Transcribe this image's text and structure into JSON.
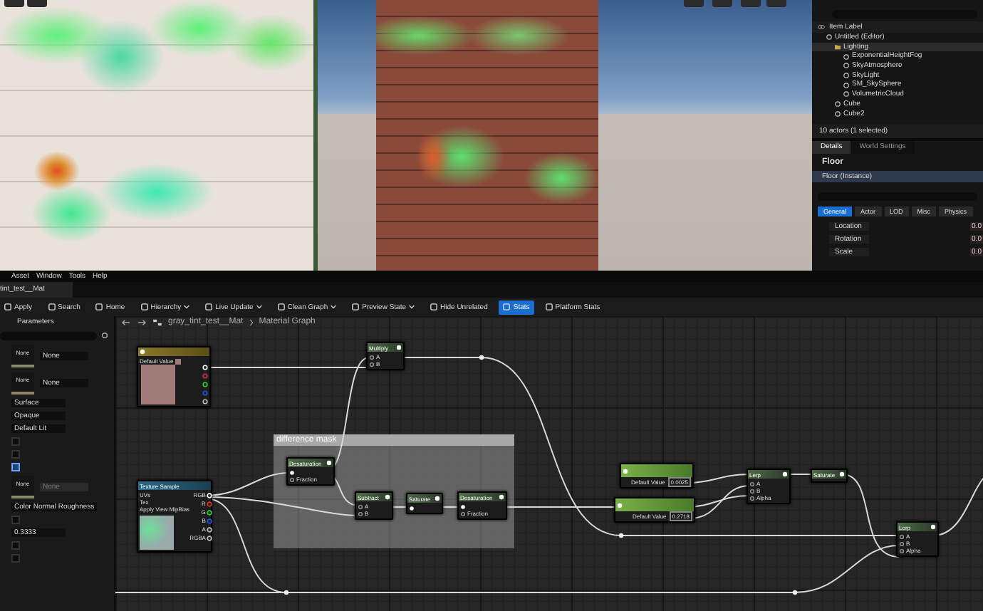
{
  "outliner": {
    "column": "Item Label",
    "items": [
      {
        "label": "Untitled (Editor)",
        "selected": false,
        "children": [
          {
            "label": "Lighting",
            "selected": true,
            "children": [
              {
                "label": "ExponentialHeightFog",
                "selected": false
              },
              {
                "label": "SkyAtmosphere",
                "selected": false
              },
              {
                "label": "SkyLight",
                "selected": false
              },
              {
                "label": "SM_SkySphere",
                "selected": false
              },
              {
                "label": "VolumetricCloud",
                "selected": false
              }
            ]
          },
          {
            "label": "Cube",
            "selected": false
          },
          {
            "label": "Cube2",
            "selected": false
          }
        ]
      }
    ],
    "status": "10 actors (1 selected)"
  },
  "details": {
    "tabs": [
      {
        "label": "Details",
        "selected": true
      },
      {
        "label": "World Settings",
        "selected": false
      }
    ],
    "actor": "Floor",
    "component": {
      "label": "Floor (Instance)",
      "selected": true
    },
    "categories": [
      {
        "label": "General",
        "selected": true
      },
      {
        "label": "Actor",
        "selected": false
      },
      {
        "label": "LOD",
        "selected": false
      },
      {
        "label": "Misc",
        "selected": false
      },
      {
        "label": "Physics",
        "selected": false
      }
    ],
    "transform": [
      {
        "label": "Location",
        "value": "0.0"
      },
      {
        "label": "Rotation",
        "value": "0.0"
      },
      {
        "label": "Scale",
        "value": "0.0"
      }
    ]
  },
  "menu": [
    "Asset",
    "Window",
    "Tools",
    "Help"
  ],
  "editor_tab": "tint_test__Mat",
  "toolbar": [
    {
      "label": "Apply",
      "selected": false,
      "dropdown": false
    },
    {
      "label": "Search",
      "selected": false,
      "dropdown": false
    },
    {
      "label": "Home",
      "selected": false,
      "dropdown": false
    },
    {
      "label": "Hierarchy",
      "selected": false,
      "dropdown": true
    },
    {
      "label": "Live Update",
      "selected": false,
      "dropdown": true
    },
    {
      "label": "Clean Graph",
      "selected": false,
      "dropdown": true
    },
    {
      "label": "Preview State",
      "selected": false,
      "dropdown": true
    },
    {
      "label": "Hide Unrelated",
      "selected": false,
      "dropdown": false
    },
    {
      "label": "Stats",
      "selected": true,
      "dropdown": false
    },
    {
      "label": "Platform Stats",
      "selected": false,
      "dropdown": false
    }
  ],
  "parameters": {
    "title": "Parameters",
    "rows": [
      {
        "kind": "slot",
        "thumb": "None",
        "value": "None",
        "disabled": false
      },
      {
        "kind": "slot",
        "thumb": "None",
        "value": "None",
        "disabled": false
      },
      {
        "kind": "dropdown",
        "value": "Surface"
      },
      {
        "kind": "dropdown",
        "value": "Opaque"
      },
      {
        "kind": "dropdown",
        "value": "Default Lit"
      },
      {
        "kind": "checkbox",
        "checked": false
      },
      {
        "kind": "checkbox",
        "checked": false
      },
      {
        "kind": "checkbox",
        "checked": true
      },
      {
        "kind": "slot",
        "thumb": "None",
        "value": "None",
        "disabled": true
      },
      {
        "kind": "dropdown",
        "value": "Color Normal Roughness"
      },
      {
        "kind": "checkbox",
        "checked": false
      },
      {
        "kind": "field",
        "value": "0.3333"
      },
      {
        "kind": "checkbox",
        "checked": false
      },
      {
        "kind": "checkbox",
        "checked": false
      }
    ]
  },
  "breadcrumb": {
    "asset": "gray_tint_test__Mat",
    "graph": "Material Graph"
  },
  "graph": {
    "comment": "difference mask",
    "nodes": [
      {
        "kind": "param",
        "value_label": "Default Value"
      },
      {
        "kind": "texture",
        "title": "Texture Sample",
        "inputs": [
          "UVs",
          "Tex",
          "Apply View MipBias"
        ],
        "outputs": [
          {
            "label": "RGB",
            "color": "#ffffff"
          },
          {
            "label": "R",
            "color": "#e03030"
          },
          {
            "label": "G",
            "color": "#30d030"
          },
          {
            "label": "B",
            "color": "#3050e0"
          },
          {
            "label": "A",
            "color": "#bbbbbb"
          },
          {
            "label": "RGBA",
            "color": "#bbbbbb"
          }
        ]
      },
      {
        "kind": "op",
        "title": "Multiply",
        "inputs": [
          "A",
          "B"
        ]
      },
      {
        "kind": "op",
        "title": "Desaturation",
        "inputs": [
          "Fraction"
        ]
      },
      {
        "kind": "op",
        "title": "Subtract",
        "inputs": [
          "A",
          "B"
        ]
      },
      {
        "kind": "op",
        "title": "Saturate"
      },
      {
        "kind": "op",
        "title": "Desaturation",
        "inputs": [
          "Fraction"
        ]
      },
      {
        "kind": "scalar",
        "value_label": "Default Value",
        "value": "0.0025"
      },
      {
        "kind": "scalar",
        "value_label": "Default Value",
        "value": "0.2718"
      },
      {
        "kind": "op",
        "title": "Lerp",
        "inputs": [
          "A",
          "B",
          "Alpha"
        ]
      },
      {
        "kind": "op",
        "title": "Saturate"
      },
      {
        "kind": "op",
        "title": "Lerp",
        "inputs": [
          "A",
          "B",
          "Alpha"
        ]
      }
    ]
  }
}
